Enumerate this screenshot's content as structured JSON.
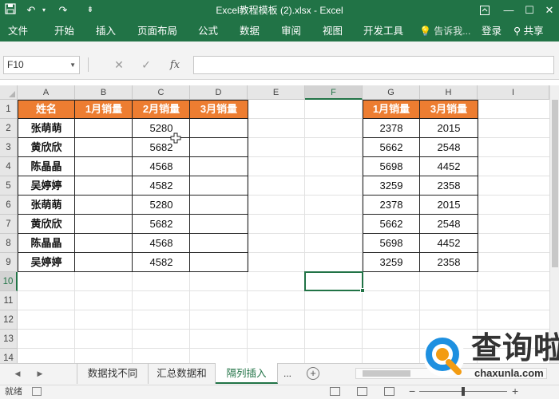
{
  "window": {
    "title": "Excel教程模板 (2).xlsx - Excel",
    "accent": "#217346"
  },
  "ribbon": {
    "tabs": [
      "文件",
      "开始",
      "插入",
      "页面布局",
      "公式",
      "数据",
      "审阅",
      "视图",
      "开发工具"
    ],
    "tell_me": "告诉我...",
    "login": "登录",
    "share": "共享"
  },
  "formula_bar": {
    "name_box": "F10",
    "fx_label": "fx",
    "formula": ""
  },
  "grid": {
    "columns": [
      "A",
      "B",
      "C",
      "D",
      "E",
      "F",
      "G",
      "H",
      "I"
    ],
    "rows": [
      "1",
      "2",
      "3",
      "4",
      "5",
      "6",
      "7",
      "8",
      "9",
      "10",
      "11",
      "12",
      "13",
      "14"
    ],
    "selected_column": "F",
    "selected_row": "10",
    "header_fill": "#ed7d31"
  },
  "table_left": {
    "headers": [
      "姓名",
      "1月销量",
      "2月销量",
      "3月销量"
    ],
    "rows": [
      [
        "张萌萌",
        "",
        "5280",
        ""
      ],
      [
        "黄欣欣",
        "",
        "5682",
        ""
      ],
      [
        "陈晶晶",
        "",
        "4568",
        ""
      ],
      [
        "吴婷婷",
        "",
        "4582",
        ""
      ],
      [
        "张萌萌",
        "",
        "5280",
        ""
      ],
      [
        "黄欣欣",
        "",
        "5682",
        ""
      ],
      [
        "陈晶晶",
        "",
        "4568",
        ""
      ],
      [
        "吴婷婷",
        "",
        "4582",
        ""
      ]
    ]
  },
  "table_right": {
    "headers": [
      "1月销量",
      "3月销量"
    ],
    "rows": [
      [
        "2378",
        "2015"
      ],
      [
        "5662",
        "2548"
      ],
      [
        "5698",
        "4452"
      ],
      [
        "3259",
        "2358"
      ],
      [
        "2378",
        "2015"
      ],
      [
        "5662",
        "2548"
      ],
      [
        "5698",
        "4452"
      ],
      [
        "3259",
        "2358"
      ]
    ]
  },
  "sheets": {
    "tabs": [
      "数据找不同",
      "汇总数据和",
      "隔列插入"
    ],
    "active": "隔列插入",
    "more": "..."
  },
  "status": {
    "text": "就绪",
    "zoom_fraction": 0.5
  },
  "watermark": {
    "title": "查询啦",
    "domain": "chaxunla.com"
  }
}
